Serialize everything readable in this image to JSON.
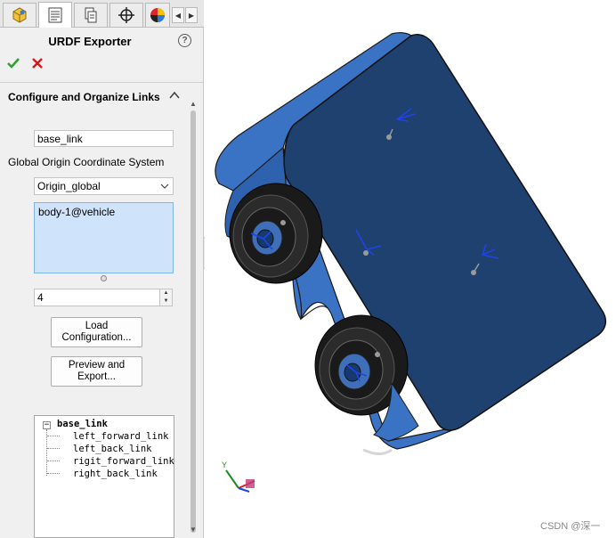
{
  "tabs": [
    {
      "name": "feature-manager-icon",
      "active": false
    },
    {
      "name": "property-manager-icon",
      "active": true
    },
    {
      "name": "configuration-manager-icon",
      "active": false
    },
    {
      "name": "dimxpert-icon",
      "active": false
    },
    {
      "name": "display-manager-icon",
      "active": false
    }
  ],
  "panel": {
    "title": "URDF Exporter",
    "help_glyph": "?",
    "section_title": "Configure and Organize Links",
    "link_name": "base_link",
    "origin_label": "Global Origin Coordinate System",
    "origin_selected": "Origin_global",
    "selected_component": "body-1@vehicle",
    "child_count": "4",
    "load_button": [
      "Load",
      "Configuration..."
    ],
    "preview_button": [
      "Preview and",
      "Export..."
    ]
  },
  "tree": {
    "root": "base_link",
    "children": [
      "left_forward_link",
      "left_back_link",
      "rigit_forward_link",
      "right_back_link"
    ]
  },
  "triad": {
    "y_label": "Y"
  },
  "watermark": "CSDN @深一",
  "colors": {
    "body_front": "#1e3f6b",
    "body_side": "#3369b8",
    "accent_blue": "#0a3cc8",
    "list_selection": "#cfe3fa",
    "ok_green": "#2fa32f",
    "cancel_red": "#d7191c"
  }
}
